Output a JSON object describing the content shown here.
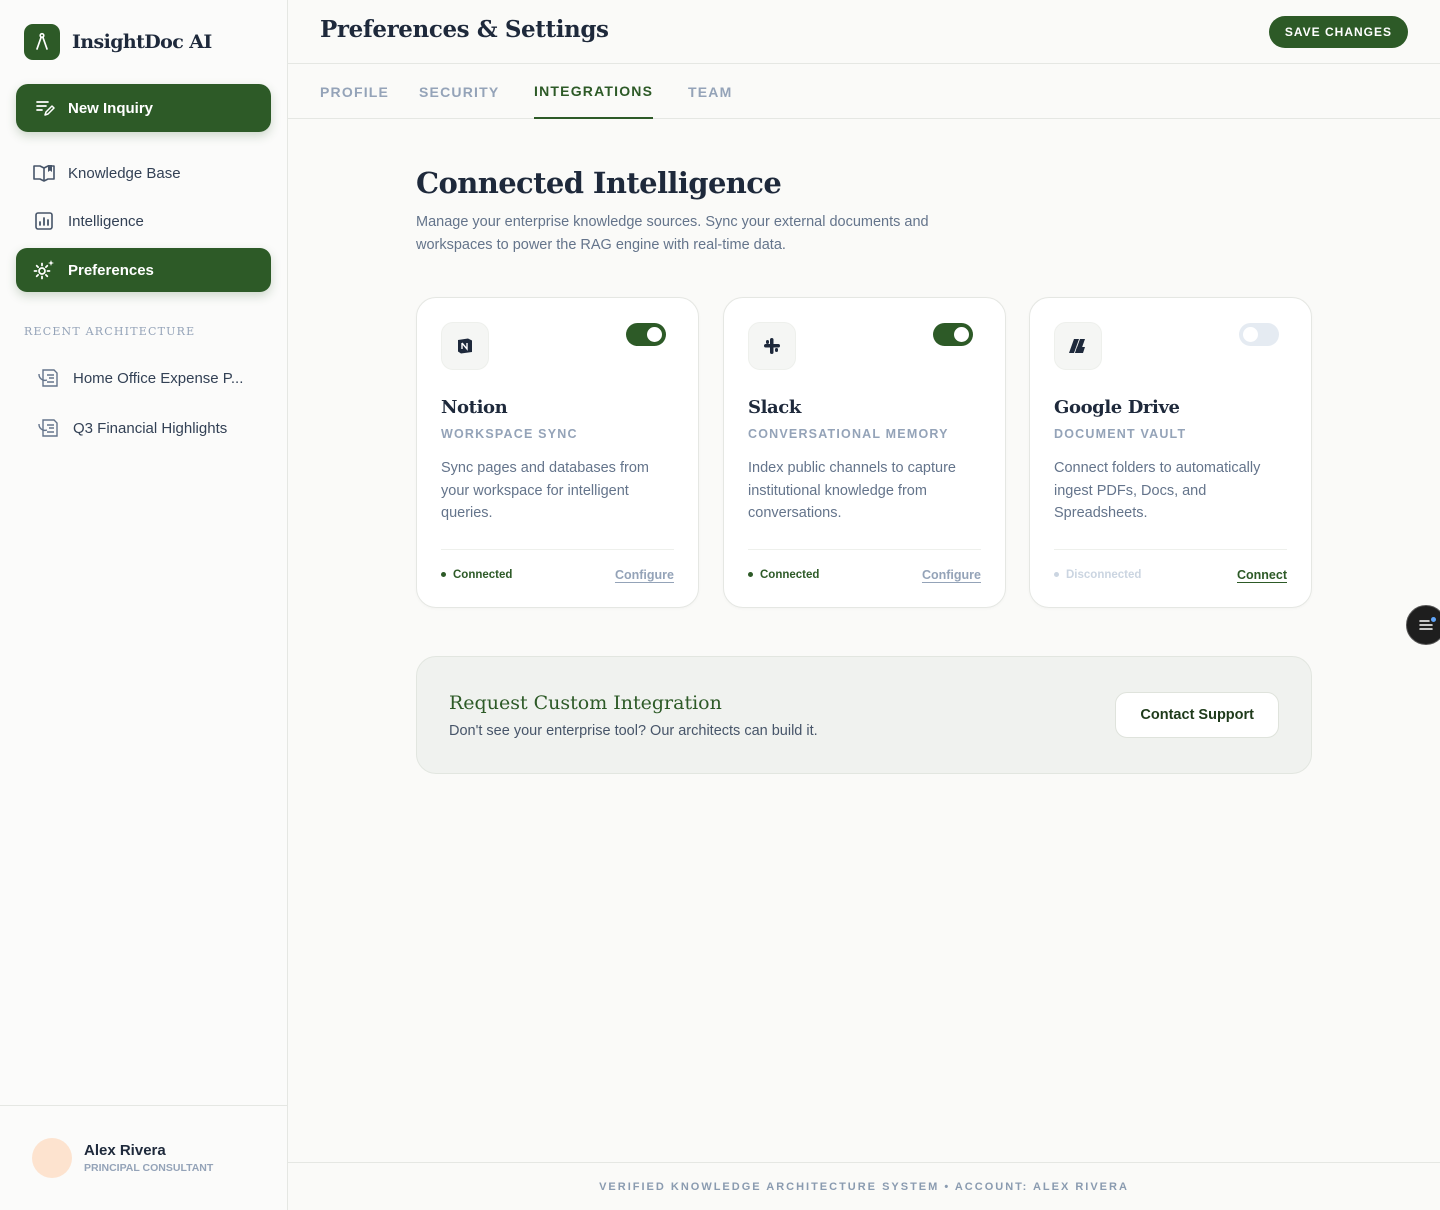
{
  "brand": {
    "name": "InsightDoc AI",
    "icon": "compass-icon"
  },
  "sidebar": {
    "new_inquiry": {
      "label": "New Inquiry",
      "icon": "edit-list-icon"
    },
    "nav": [
      {
        "label": "Knowledge Base",
        "icon": "book-icon",
        "active": false
      },
      {
        "label": "Intelligence",
        "icon": "chart-icon",
        "active": false
      },
      {
        "label": "Preferences",
        "icon": "settings-sparkle-icon",
        "active": true
      }
    ],
    "recent_label": "Recent Architecture",
    "recent": [
      {
        "label": "Home Office Expense P...",
        "icon": "document-history-icon"
      },
      {
        "label": "Q3 Financial Highlights",
        "icon": "document-history-icon"
      }
    ],
    "user": {
      "name": "Alex Rivera",
      "role": "PRINCIPAL CONSULTANT"
    }
  },
  "header": {
    "title": "Preferences & Settings",
    "save_label": "SAVE CHANGES"
  },
  "tabs": [
    {
      "label": "PROFILE",
      "active": false
    },
    {
      "label": "SECURITY",
      "active": false
    },
    {
      "label": "INTEGRATIONS",
      "active": true
    },
    {
      "label": "TEAM",
      "active": false
    }
  ],
  "main": {
    "title": "Connected Intelligence",
    "description": "Manage your enterprise knowledge sources. Sync your external documents and workspaces to power the RAG engine with real-time data."
  },
  "integrations": [
    {
      "name": "Notion",
      "subtitle": "WORKSPACE SYNC",
      "icon": "notion-icon",
      "description": "Sync pages and databases from your workspace for intelligent queries.",
      "enabled": true,
      "status": "Connected",
      "action": "Configure"
    },
    {
      "name": "Slack",
      "subtitle": "CONVERSATIONAL MEMORY",
      "icon": "slack-icon",
      "description": "Index public channels to capture institutional knowledge from conversations.",
      "enabled": true,
      "status": "Connected",
      "action": "Configure"
    },
    {
      "name": "Google Drive",
      "subtitle": "DOCUMENT VAULT",
      "icon": "drive-icon",
      "description": "Connect folders to automatically ingest PDFs, Docs, and Spreadsheets.",
      "enabled": false,
      "status": "Disconnected",
      "action": "Connect"
    }
  ],
  "custom": {
    "title": "Request Custom Integration",
    "description": "Don't see your enterprise tool? Our architects can build it.",
    "button": "Contact Support"
  },
  "footer": {
    "text": "VERIFIED KNOWLEDGE ARCHITECTURE SYSTEM • ACCOUNT: ALEX RIVERA"
  },
  "colors": {
    "accent": "#2d5a27",
    "muted": "#94a3b8",
    "background": "#fafaf8"
  }
}
